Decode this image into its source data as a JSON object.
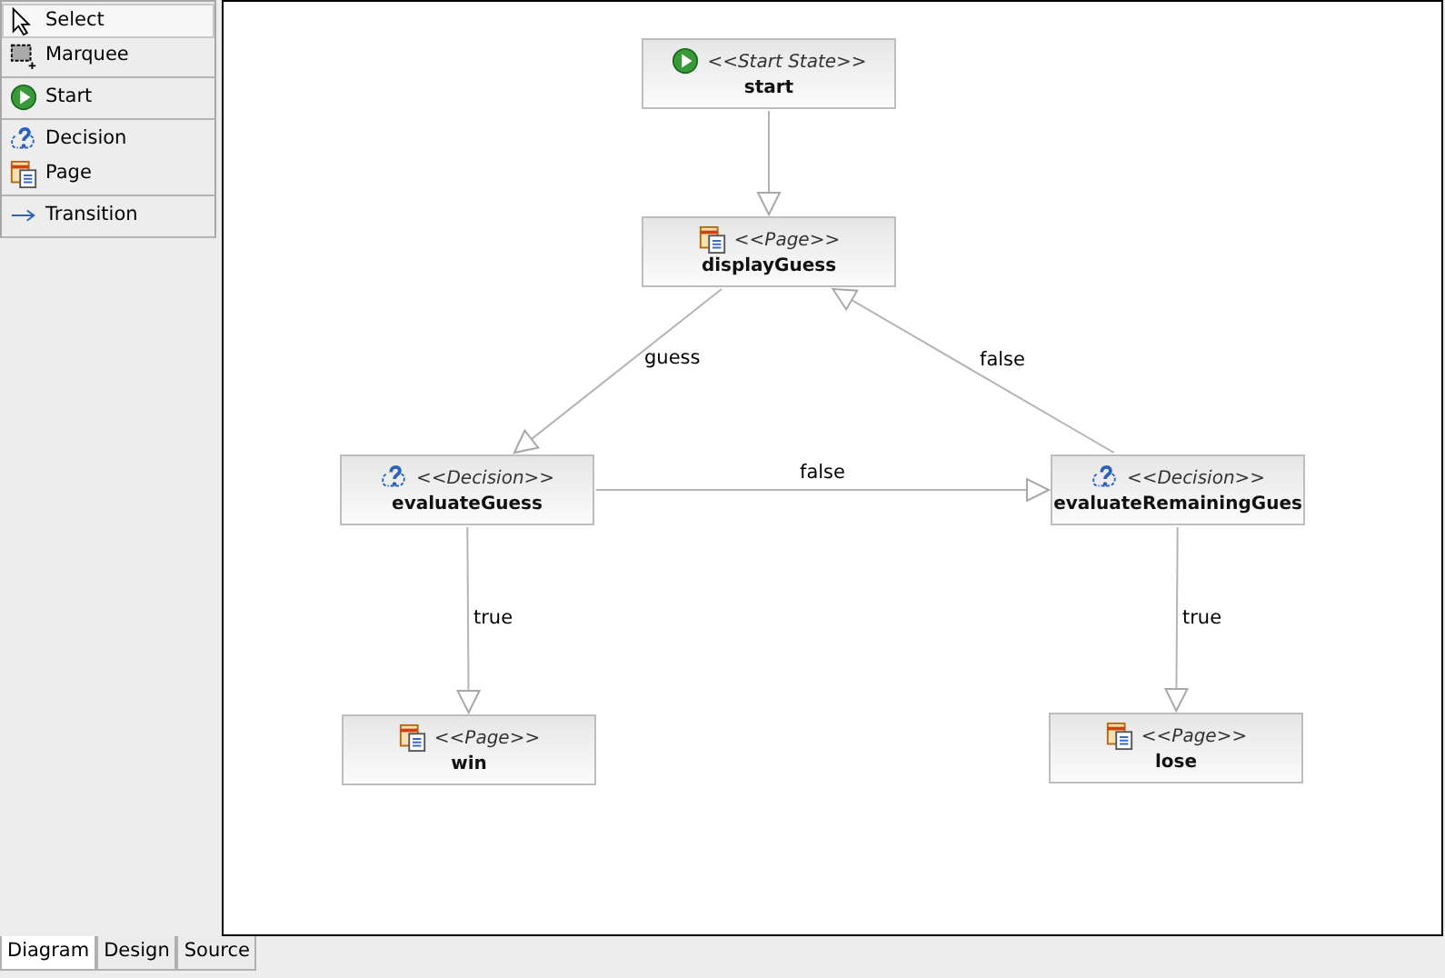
{
  "palette": [
    {
      "items": [
        {
          "label": "Select",
          "kind": "select",
          "selected": true
        },
        {
          "label": "Marquee",
          "kind": "marquee",
          "selected": false
        }
      ]
    },
    {
      "items": [
        {
          "label": "Start",
          "kind": "start",
          "selected": false
        }
      ]
    },
    {
      "items": [
        {
          "label": "Decision",
          "kind": "decision",
          "selected": false
        },
        {
          "label": "Page",
          "kind": "page",
          "selected": false
        }
      ]
    },
    {
      "items": [
        {
          "label": "Transition",
          "kind": "transition",
          "selected": false
        }
      ]
    }
  ],
  "diagram": {
    "nodes": [
      {
        "kind": "start",
        "stereotype": "<<Start State>>",
        "name": "start"
      },
      {
        "kind": "page",
        "stereotype": "<<Page>>",
        "name": "displayGuess"
      },
      {
        "kind": "decision",
        "stereotype": "<<Decision>>",
        "name": "evaluateGuess"
      },
      {
        "kind": "decision",
        "stereotype": "<<Decision>>",
        "name": "evaluateRemainingGues"
      },
      {
        "kind": "page",
        "stereotype": "<<Page>>",
        "name": "win"
      },
      {
        "kind": "page",
        "stereotype": "<<Page>>",
        "name": "lose"
      }
    ],
    "transitions": [
      {
        "kind": "transition"
      },
      {
        "kind": "transition",
        "label": "guess"
      },
      {
        "kind": "transition",
        "label": "false"
      },
      {
        "kind": "transition",
        "label": "false"
      },
      {
        "kind": "transition",
        "label": "true"
      },
      {
        "kind": "transition",
        "label": "true"
      }
    ]
  },
  "tabs": [
    {
      "label": "Diagram",
      "selected": true
    },
    {
      "label": "Design",
      "selected": false
    },
    {
      "label": "Source",
      "selected": false
    }
  ]
}
